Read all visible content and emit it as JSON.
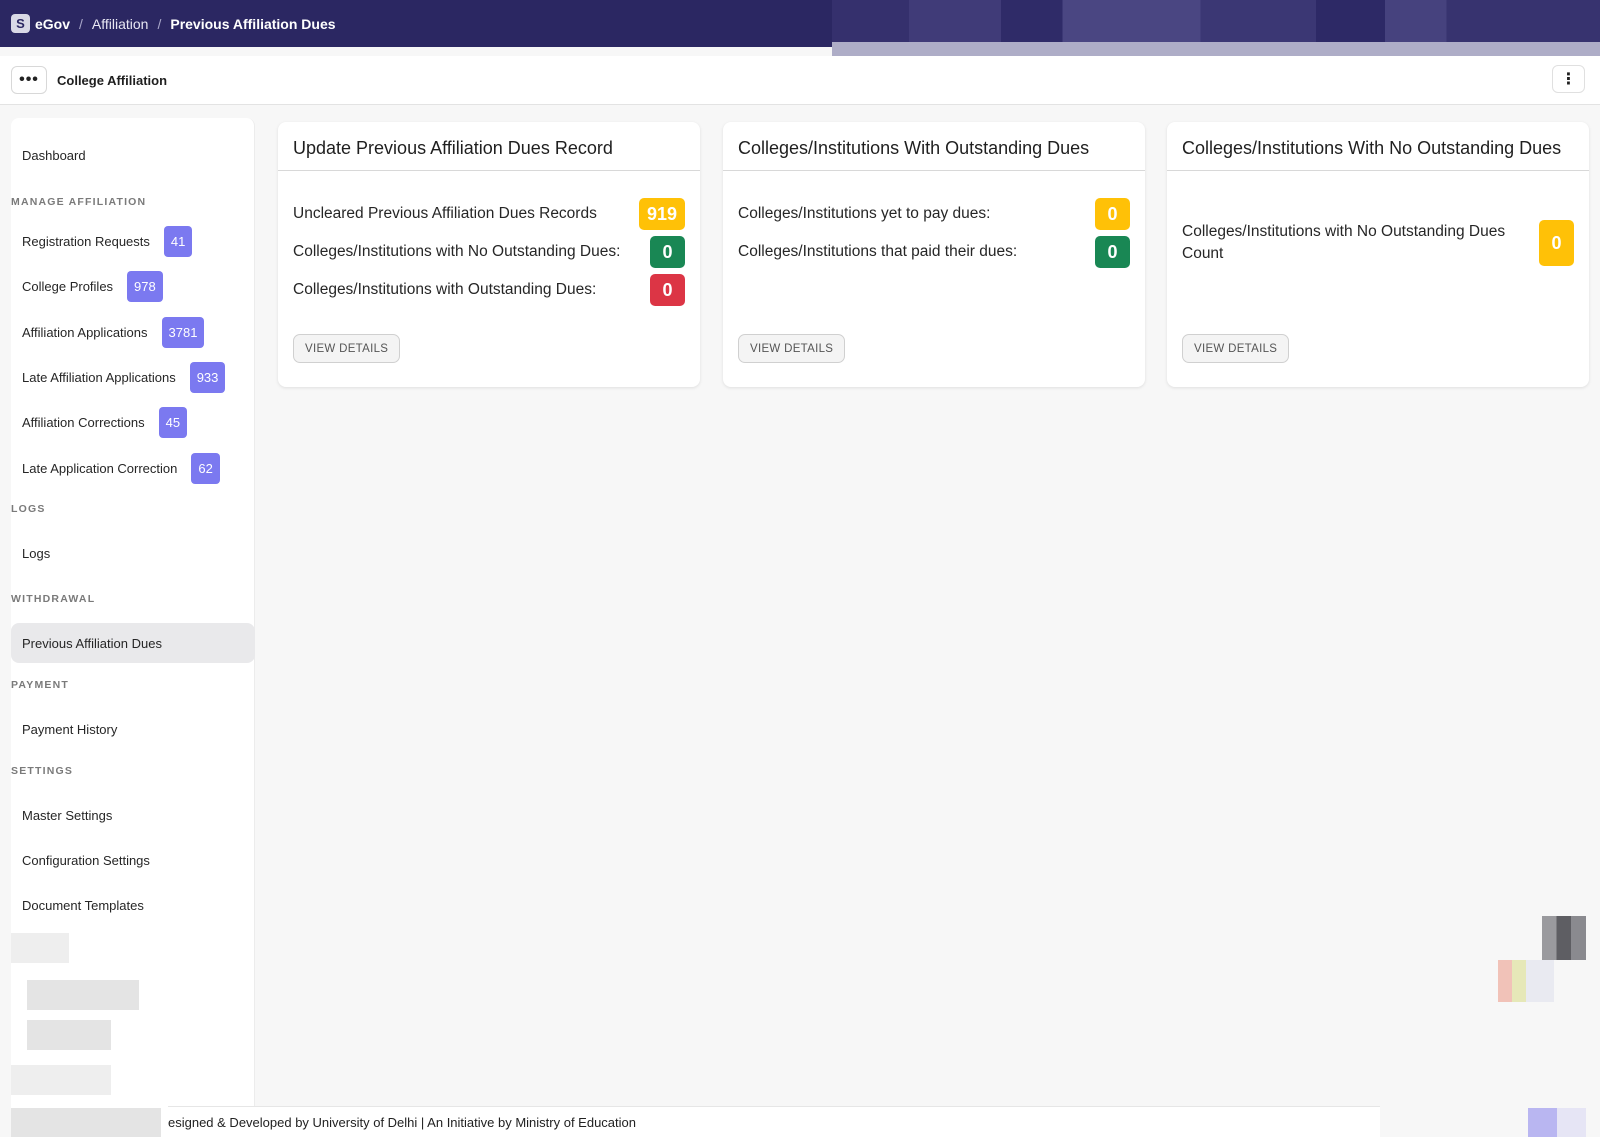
{
  "navbar": {
    "logo_letter": "S",
    "brand": "eGov",
    "breadcrumbs": [
      "Affiliation",
      "Previous Affiliation Dues"
    ],
    "separator": "/"
  },
  "subheader": {
    "menu_glyph": "•••",
    "title": "College Affiliation",
    "kebab_glyph": "⋮"
  },
  "sidebar": {
    "dashboard": "Dashboard",
    "sections": {
      "manage": "MANAGE AFFILIATION",
      "logs": "LOGS",
      "withdrawal": "WITHDRAWAL",
      "payment": "PAYMENT",
      "settings": "SETTINGS"
    },
    "manage_items": [
      {
        "label": "Registration Requests",
        "badge": "41"
      },
      {
        "label": "College Profiles",
        "badge": "978"
      },
      {
        "label": "Affiliation Applications",
        "badge": "3781"
      },
      {
        "label": "Late Affiliation Applications",
        "badge": "933"
      },
      {
        "label": "Affiliation Corrections",
        "badge": "45"
      },
      {
        "label": "Late Application Correction",
        "badge": "62"
      }
    ],
    "logs_item": "Logs",
    "withdrawal_item": "Previous Affiliation Dues",
    "payment_item": "Payment History",
    "settings_items": [
      "Master Settings",
      "Configuration Settings",
      "Document Templates"
    ],
    "badge_color": "#7b79f0"
  },
  "cards": [
    {
      "title": "Update Previous Affiliation Dues Record",
      "rows": [
        {
          "label": "Uncleared Previous Affiliation Dues Records",
          "value": "919",
          "color": "yellow"
        },
        {
          "label": "Colleges/Institutions with No Outstanding Dues:",
          "value": "0",
          "color": "green"
        },
        {
          "label": "Colleges/Institutions with Outstanding Dues:",
          "value": "0",
          "color": "red"
        }
      ],
      "button": "VIEW DETAILS"
    },
    {
      "title": "Colleges/Institutions With Outstanding Dues",
      "rows": [
        {
          "label": "Colleges/Institutions yet to pay dues:",
          "value": "0",
          "color": "yellow"
        },
        {
          "label": "Colleges/Institutions that paid their dues:",
          "value": "0",
          "color": "green"
        }
      ],
      "button": "VIEW DETAILS"
    },
    {
      "title": "Colleges/Institutions With No Outstanding Dues",
      "rows": [
        {
          "label": "Colleges/Institutions with No Outstanding Dues Count",
          "value": "0",
          "color": "yellow"
        }
      ],
      "button": "VIEW DETAILS"
    }
  ],
  "status_colors": {
    "yellow": "#ffc107",
    "green": "#198754",
    "red": "#dc3545",
    "navbar": "#2b2762"
  },
  "footer": {
    "text": "esigned & Developed by University of Delhi | An Initiative by Ministry of Education"
  }
}
